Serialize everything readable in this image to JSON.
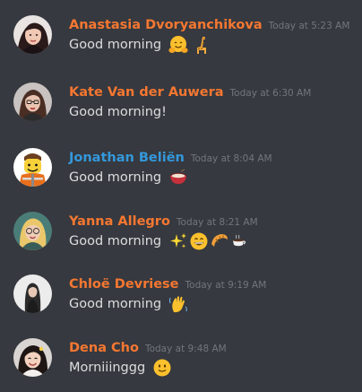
{
  "messages": [
    {
      "username": "Anastasia Dvoryanchikova",
      "username_color": "#f57731",
      "timestamp": "Today at 5:23 AM",
      "text": "Good morning",
      "emojis": [
        "hugging-face-emoji",
        "giraffe-emoji"
      ]
    },
    {
      "username": "Kate Van der Auwera",
      "username_color": "#f57731",
      "timestamp": "Today at 6:30 AM",
      "text": "Good morning!",
      "emojis": []
    },
    {
      "username": "Jonathan Beliën",
      "username_color": "#3498db",
      "timestamp": "Today at 8:04 AM",
      "text": "Good morning",
      "emojis": [
        "bowl-emoji"
      ]
    },
    {
      "username": "Yanna Allegro",
      "username_color": "#f57731",
      "timestamp": "Today at 8:21 AM",
      "text": "Good morning",
      "emojis": [
        "sparkles-emoji",
        "grinning-emoji",
        "croissant-emoji",
        "coffee-emoji"
      ]
    },
    {
      "username": "Chloë Devriese",
      "username_color": "#f57731",
      "timestamp": "Today at 9:19 AM",
      "text": "Good morning",
      "emojis": [
        "waving-hand-emoji"
      ]
    },
    {
      "username": "Dena Cho",
      "username_color": "#f57731",
      "timestamp": "Today at 9:48 AM",
      "text": "Morniiinggg",
      "emojis": [
        "slight-smile-emoji"
      ]
    }
  ],
  "colors": {
    "background": "#36393f",
    "message_text": "#dcddde",
    "timestamp": "#72767d"
  }
}
